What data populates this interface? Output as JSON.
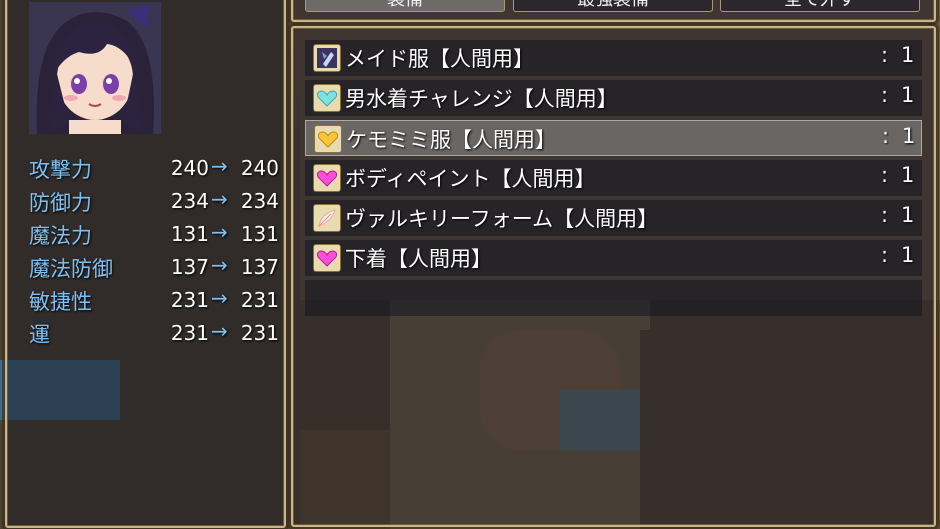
{
  "tabs": [
    {
      "label": "装備",
      "selected": true
    },
    {
      "label": "最強装備",
      "selected": false
    },
    {
      "label": "全て外す",
      "selected": false
    }
  ],
  "character": {
    "portrait_icon": "girl-portrait",
    "stats": [
      {
        "name": "攻撃力",
        "current": "240",
        "arrow": "→",
        "new": "240"
      },
      {
        "name": "防御力",
        "current": "234",
        "arrow": "→",
        "new": "234"
      },
      {
        "name": "魔法力",
        "current": "131",
        "arrow": "→",
        "new": "131"
      },
      {
        "name": "魔法防御",
        "current": "137",
        "arrow": "→",
        "new": "137"
      },
      {
        "name": "敏捷性",
        "current": "231",
        "arrow": "→",
        "new": "231"
      },
      {
        "name": "運",
        "current": "231",
        "arrow": "→",
        "new": "231"
      }
    ]
  },
  "items": [
    {
      "name": "メイド服【人間用】",
      "colon": ":",
      "count": "1",
      "icon": "maid-outfit-icon",
      "selected": false
    },
    {
      "name": "男水着チャレンジ【人間用】",
      "colon": ":",
      "count": "1",
      "icon": "cyan-heart-icon",
      "selected": false
    },
    {
      "name": "ケモミミ服【人間用】",
      "colon": ":",
      "count": "1",
      "icon": "orange-heart-icon",
      "selected": true
    },
    {
      "name": "ボディペイント【人間用】",
      "colon": ":",
      "count": "1",
      "icon": "pink-heart-icon",
      "selected": false
    },
    {
      "name": "ヴァルキリーフォーム【人間用】",
      "colon": ":",
      "count": "1",
      "icon": "feather-icon",
      "selected": false
    },
    {
      "name": "下着【人間用】",
      "colon": ":",
      "count": "1",
      "icon": "pink-heart-icon",
      "selected": false
    }
  ],
  "colors": {
    "stat_label": "#7ec0f2",
    "text": "#ffffff",
    "border": "#c9b58a",
    "cyan_heart": "#7fe0e0",
    "orange_heart": "#ffc53a",
    "pink_heart": "#ff4fd8"
  }
}
